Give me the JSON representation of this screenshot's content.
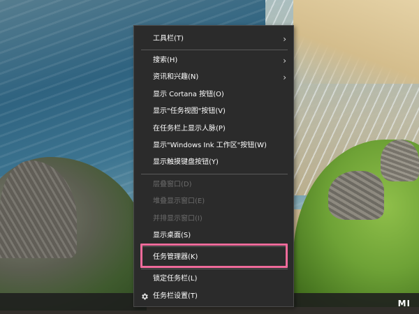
{
  "context_menu": {
    "items": [
      {
        "label": "工具栏(T)",
        "has_submenu": true,
        "enabled": true
      },
      {
        "label": "搜索(H)",
        "has_submenu": true,
        "enabled": true
      },
      {
        "label": "资讯和兴趣(N)",
        "has_submenu": true,
        "enabled": true
      },
      {
        "label": "显示 Cortana 按钮(O)",
        "has_submenu": false,
        "enabled": true
      },
      {
        "label": "显示\"任务视图\"按钮(V)",
        "has_submenu": false,
        "enabled": true
      },
      {
        "label": "在任务栏上显示人脉(P)",
        "has_submenu": false,
        "enabled": true
      },
      {
        "label": "显示\"Windows Ink 工作区\"按钮(W)",
        "has_submenu": false,
        "enabled": true
      },
      {
        "label": "显示触摸键盘按钮(Y)",
        "has_submenu": false,
        "enabled": true
      },
      {
        "label": "层叠窗口(D)",
        "has_submenu": false,
        "enabled": false
      },
      {
        "label": "堆叠显示窗口(E)",
        "has_submenu": false,
        "enabled": false
      },
      {
        "label": "并排显示窗口(I)",
        "has_submenu": false,
        "enabled": false
      },
      {
        "label": "显示桌面(S)",
        "has_submenu": false,
        "enabled": true
      },
      {
        "label": "任务管理器(K)",
        "has_submenu": false,
        "enabled": true,
        "highlighted": true
      },
      {
        "label": "锁定任务栏(L)",
        "has_submenu": false,
        "enabled": true
      },
      {
        "label": "任务栏设置(T)",
        "has_submenu": false,
        "enabled": true,
        "icon": "gear-icon"
      }
    ],
    "submenu_glyph": "›"
  },
  "watermark": "MI",
  "colors": {
    "menu_background": "#2b2b2b",
    "highlight_border": "#f06b9b",
    "disabled_text": "#6c6c6c"
  }
}
